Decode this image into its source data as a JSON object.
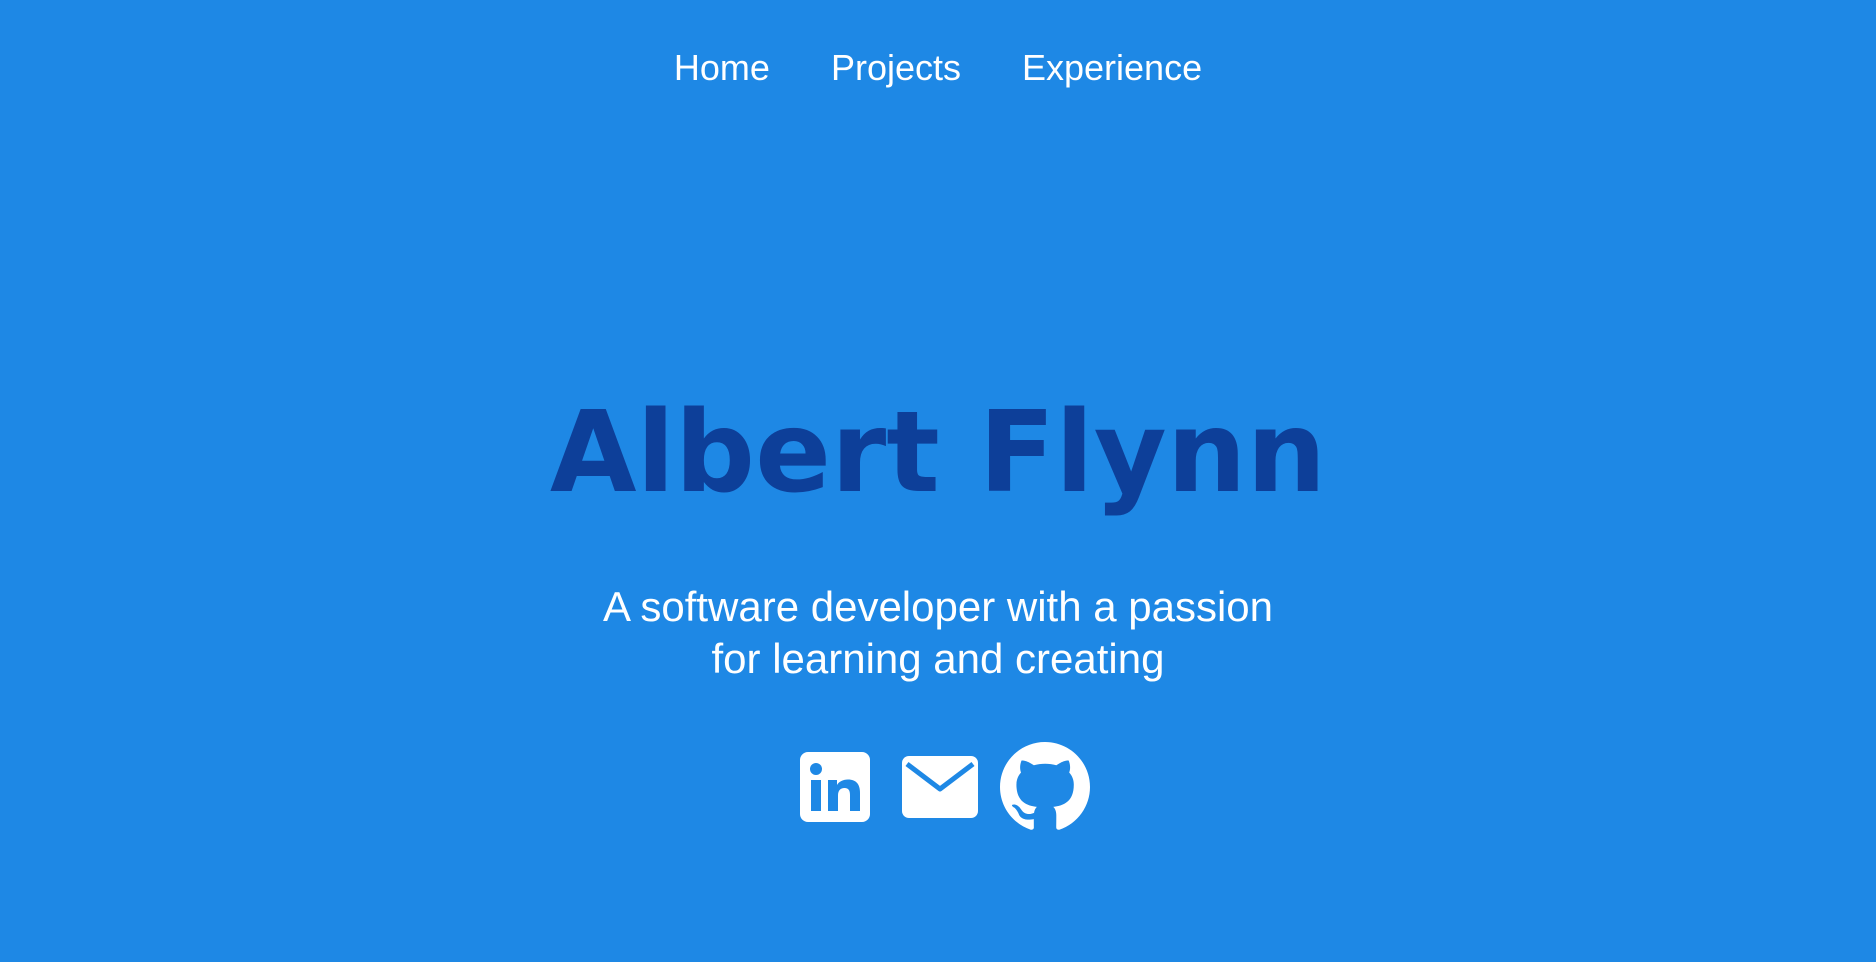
{
  "nav": {
    "items": [
      {
        "label": "Home"
      },
      {
        "label": "Projects"
      },
      {
        "label": "Experience"
      }
    ]
  },
  "hero": {
    "name": "Albert Flynn",
    "tagline_line1": "A software developer with a passion",
    "tagline_line2": "for learning and creating"
  },
  "socials": [
    {
      "icon": "linkedin-icon"
    },
    {
      "icon": "email-icon"
    },
    {
      "icon": "github-icon"
    }
  ],
  "colors": {
    "background": "#1e88e5",
    "name": "#0d3f99",
    "text": "#ffffff"
  }
}
